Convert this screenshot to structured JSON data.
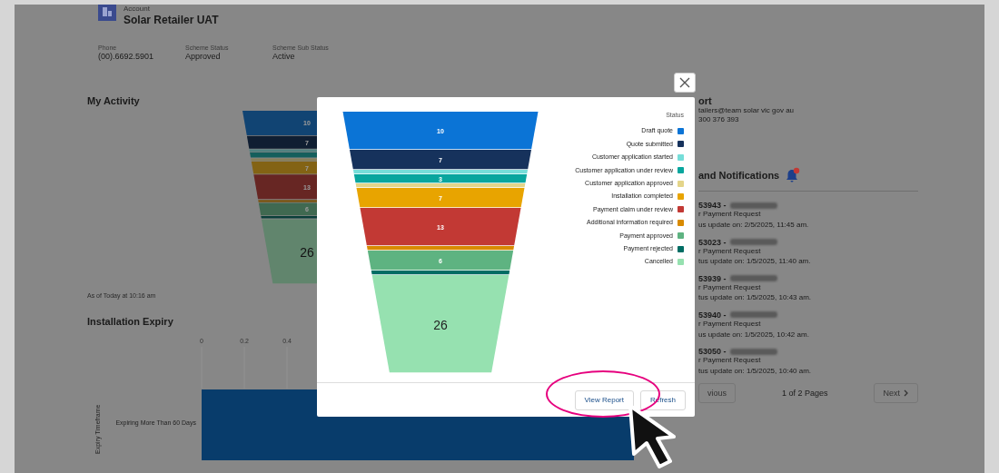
{
  "account": {
    "label": "Account",
    "name": "Solar Retailer UAT"
  },
  "fields": [
    {
      "label": "Phone",
      "value": "(00).6692.5901"
    },
    {
      "label": "Scheme Status",
      "value": "Approved"
    },
    {
      "label": "Scheme Sub Status",
      "value": "Active"
    }
  ],
  "activity": {
    "title": "My Activity",
    "timestamp": "As of Today at 10:16 am",
    "funnel": [
      {
        "label": "10",
        "kind": "tall"
      },
      {
        "label": "7",
        "kind": "medium"
      },
      {
        "kind": "thin"
      },
      {
        "kind": "narrow"
      },
      {
        "kind": "thin"
      },
      {
        "label": "7",
        "kind": "medium"
      },
      {
        "label": "13",
        "kind": "tall"
      },
      {
        "kind": "thin"
      },
      {
        "label": "6",
        "kind": "medium"
      },
      {
        "kind": "thin"
      },
      {
        "label": "26",
        "kind": "big"
      }
    ]
  },
  "expiry": {
    "title": "Installation Expiry",
    "axis_ticks": [
      "0",
      "0.2",
      "0.4"
    ],
    "axis_title": "Expiry Timeframe",
    "category": "Expiring More Than 60 Days"
  },
  "support": {
    "title": "ort",
    "email": "tailers@team solar vic gov au",
    "phone": "300 376 393"
  },
  "notifications": {
    "title": "and Notifications",
    "badge": true,
    "items": [
      {
        "id": "53943 -",
        "type": "r Payment Request",
        "status": "us update on: 2/5/2025, 11:45 am."
      },
      {
        "id": "53023 -",
        "type": "r Payment Request",
        "status": "tus update on: 1/5/2025, 11:40 am."
      },
      {
        "id": "53939 -",
        "type": "r Payment Request",
        "status": "tus update on: 1/5/2025, 10:43 am."
      },
      {
        "id": "53940 -",
        "type": "r Payment Request",
        "status": "us update on: 1/5/2025, 10:42 am."
      },
      {
        "id": "53050 -",
        "type": "r Payment Request",
        "status": "tus update on: 1/5/2025, 10:40 am."
      }
    ]
  },
  "pagination": {
    "previous": "vious",
    "info": "1 of 2 Pages",
    "next": "Next"
  },
  "modal": {
    "legend_title": "Status",
    "legend": [
      {
        "label": "Draft quote",
        "color": "#0b74d6"
      },
      {
        "label": "Quote submitted",
        "color": "#16325c"
      },
      {
        "label": "Customer application started",
        "color": "#76ded9"
      },
      {
        "label": "Customer application under review",
        "color": "#08a69e"
      },
      {
        "label": "Customer application approved",
        "color": "#e4d58a"
      },
      {
        "label": "Installation completed",
        "color": "#e8a400"
      },
      {
        "label": "Payment claim under review",
        "color": "#c23934"
      },
      {
        "label": "Additional information required",
        "color": "#d88a00"
      },
      {
        "label": "Payment approved",
        "color": "#5eb381"
      },
      {
        "label": "Payment rejected",
        "color": "#006d64"
      },
      {
        "label": "Cancelled",
        "color": "#96e1b0"
      }
    ],
    "funnel": [
      {
        "label": "10",
        "kind": "tall"
      },
      {
        "label": "7",
        "kind": "medium"
      },
      {
        "kind": "thin"
      },
      {
        "label": "3",
        "kind": "narrow"
      },
      {
        "kind": "thin"
      },
      {
        "label": "7",
        "kind": "medium"
      },
      {
        "label": "13",
        "kind": "tall"
      },
      {
        "kind": "thin"
      },
      {
        "label": "6",
        "kind": "medium"
      },
      {
        "kind": "thin"
      },
      {
        "label": "26",
        "kind": "big"
      }
    ],
    "buttons": [
      "View Report",
      "Refresh"
    ],
    "highlight": true,
    "cursor": true
  }
}
